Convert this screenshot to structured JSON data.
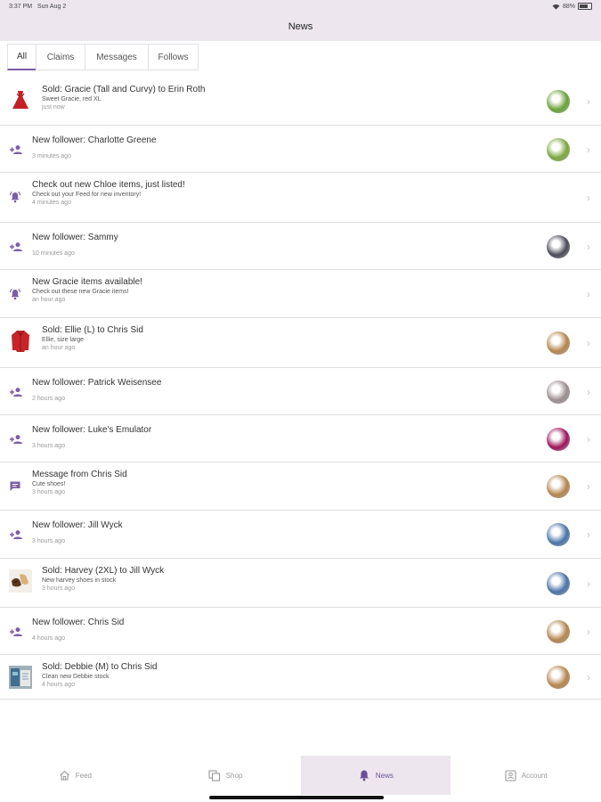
{
  "status": {
    "time": "3:37 PM",
    "date": "Sun Aug 2",
    "battery": "88%"
  },
  "header": {
    "title": "News"
  },
  "tabs": [
    {
      "label": "All",
      "active": true
    },
    {
      "label": "Claims"
    },
    {
      "label": "Messages"
    },
    {
      "label": "Follows"
    }
  ],
  "rows": [
    {
      "type": "sold",
      "icon": "red-dress-thumbnail",
      "title": "Sold: Gracie (Tall and Curvy) to Erin Roth",
      "subtitle": "Sweet Gracie, red XL",
      "time": "just now",
      "avatar_color": "#6aa33a"
    },
    {
      "type": "follower",
      "icon": "add-person-icon",
      "title": "New follower: Charlotte Greene",
      "subtitle": "",
      "time": "3 minutes ago",
      "avatar_color": "#7aa83c"
    },
    {
      "type": "alert",
      "icon": "bell-ringing-icon",
      "title": "Check out new Chloe items, just listed!",
      "subtitle": "Check out your Feed for new inventory!",
      "time": "4 minutes ago"
    },
    {
      "type": "follower",
      "icon": "add-person-icon",
      "title": "New follower: Sammy",
      "subtitle": "",
      "time": "10 minutes ago",
      "avatar_color": "#4b4b5a"
    },
    {
      "type": "alert",
      "icon": "bell-ringing-icon",
      "title": "New Gracie items available!",
      "subtitle": "Check out these new Gracie items!",
      "time": "an hour ago"
    },
    {
      "type": "sold",
      "icon": "red-jacket-thumbnail",
      "title": "Sold: Ellie (L) to Chris Sid",
      "subtitle": "Ellie, size large",
      "time": "an hour ago",
      "avatar_color": "#b5864f"
    },
    {
      "type": "follower",
      "icon": "add-person-icon",
      "title": "New follower: Patrick Weisensee",
      "subtitle": "",
      "time": "2 hours ago",
      "avatar_color": "#9a8f90"
    },
    {
      "type": "follower",
      "icon": "add-person-icon",
      "title": "New follower: Luke's Emulator",
      "subtitle": "",
      "time": "3 hours ago",
      "avatar_color": "#a0145a"
    },
    {
      "type": "message",
      "icon": "chat-icon",
      "title": "Message from Chris Sid",
      "subtitle": "Cute shoes!",
      "time": "3 hours ago",
      "avatar_color": "#b5864f"
    },
    {
      "type": "follower",
      "icon": "add-person-icon",
      "title": "New follower: Jill Wyck",
      "subtitle": "",
      "time": "3 hours ago",
      "avatar_color": "#4a74a8"
    },
    {
      "type": "sold",
      "icon": "shoes-thumbnail",
      "title": "Sold: Harvey (2XL) to Jill Wyck",
      "subtitle": "New harvey shoes in stock",
      "time": "3 hours ago",
      "avatar_color": "#4a74a8"
    },
    {
      "type": "follower",
      "icon": "add-person-icon",
      "title": "New follower: Chris Sid",
      "subtitle": "",
      "time": "4 hours ago",
      "avatar_color": "#b5864f"
    },
    {
      "type": "sold",
      "icon": "clothes-thumbnail",
      "title": "Sold: Debbie (M) to Chris Sid",
      "subtitle": "Clean new Debbie stock",
      "time": "4 hours ago",
      "avatar_color": "#b5864f"
    }
  ],
  "bottom_nav": [
    {
      "label": "Feed",
      "icon": "home-icon"
    },
    {
      "label": "Shop",
      "icon": "shop-icon"
    },
    {
      "label": "News",
      "icon": "bell-icon",
      "active": true
    },
    {
      "label": "Account",
      "icon": "account-icon"
    }
  ],
  "colors": {
    "accent": "#7b5ea7",
    "header_bg": "#ede6ef"
  }
}
